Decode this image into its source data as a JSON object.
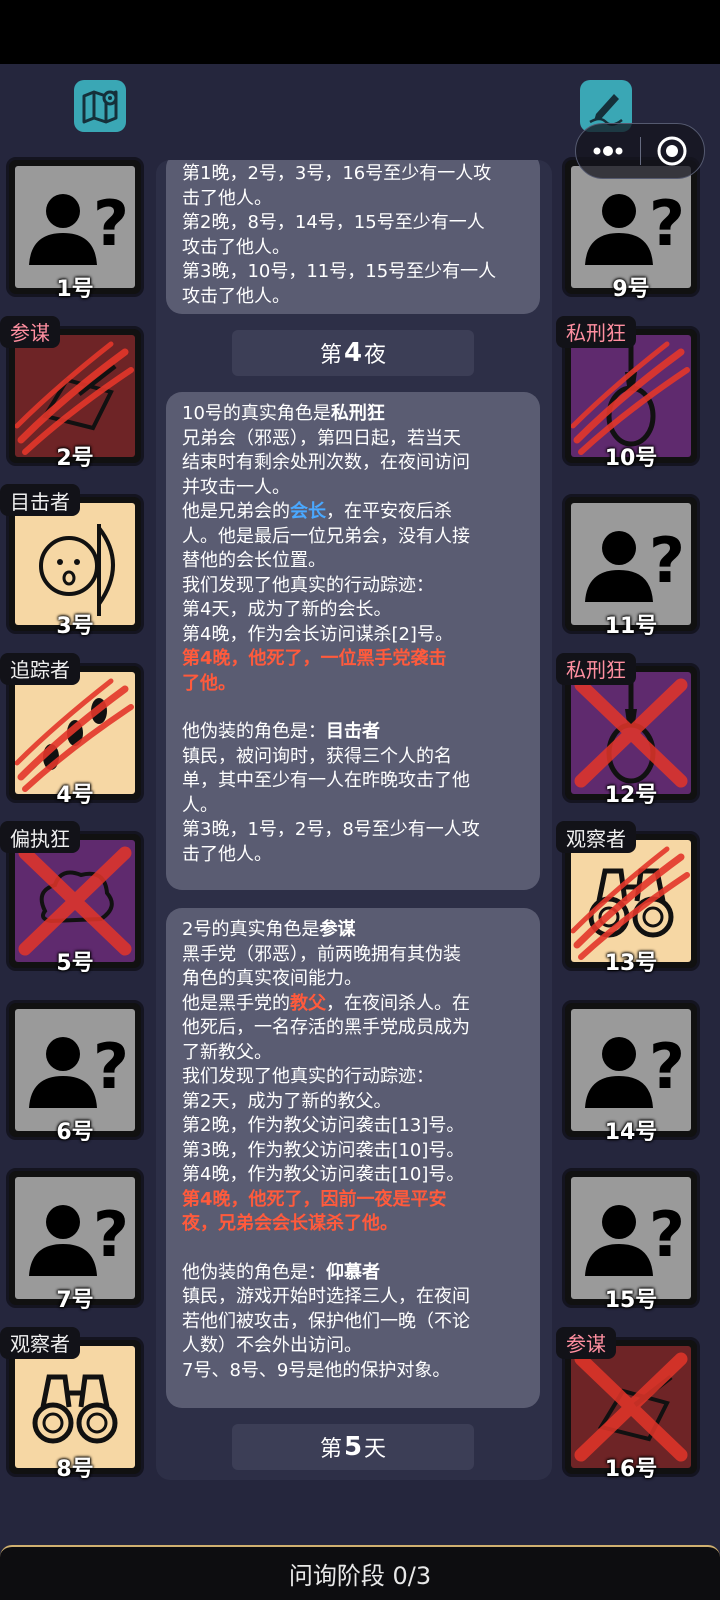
{
  "footer": {
    "phase": "问询阶段 0/3"
  },
  "toolbar": {
    "map_icon": "map-icon",
    "notes_icon": "notes-pencil-icon"
  },
  "capsule": {
    "more_icon": "more-dots-icon",
    "close_icon": "target-close-icon"
  },
  "players_left": [
    {
      "num": "1号",
      "role": "",
      "art": "unknown"
    },
    {
      "num": "2号",
      "role": "参谋",
      "art": "advisor",
      "status": "attacked"
    },
    {
      "num": "3号",
      "role": "目击者",
      "art": "witness"
    },
    {
      "num": "4号",
      "role": "追踪者",
      "art": "tracker",
      "status": "attacked"
    },
    {
      "num": "5号",
      "role": "偏执狂",
      "art": "paranoid",
      "status": "dead"
    },
    {
      "num": "6号",
      "role": "",
      "art": "unknown"
    },
    {
      "num": "7号",
      "role": "",
      "art": "unknown"
    },
    {
      "num": "8号",
      "role": "观察者",
      "art": "observer"
    }
  ],
  "players_right": [
    {
      "num": "9号",
      "role": "",
      "art": "unknown"
    },
    {
      "num": "10号",
      "role": "私刑狂",
      "art": "lyncher",
      "status": "attacked"
    },
    {
      "num": "11号",
      "role": "",
      "art": "unknown"
    },
    {
      "num": "12号",
      "role": "私刑狂",
      "art": "lyncher",
      "status": "dead"
    },
    {
      "num": "13号",
      "role": "观察者",
      "art": "observer",
      "status": "attacked"
    },
    {
      "num": "14号",
      "role": "",
      "art": "unknown"
    },
    {
      "num": "15号",
      "role": "",
      "art": "unknown"
    },
    {
      "num": "16号",
      "role": "参谋",
      "art": "advisor",
      "status": "dead"
    }
  ],
  "log": {
    "bubble1": {
      "l1": "第1晚，2号，3号，16号至少有一人攻",
      "l2": "击了他人。",
      "l3": "第2晚，8号，14号，15号至少有一人",
      "l4": "攻击了他人。",
      "l5": "第3晚，10号，11号，15号至少有一人",
      "l6": "攻击了他人。"
    },
    "night4": {
      "pre": "第",
      "num": "4",
      "post": "夜"
    },
    "bubble2": {
      "head_pre": "10号的真实角色是",
      "head_role": "私刑狂",
      "d1": "兄弟会（邪恶），第四日起，若当天",
      "d2": "结束时有剩余处刑次数，在夜间访问",
      "d3": "并攻击一人。",
      "t1a": "他是兄弟会的",
      "t1b": "会长",
      "t1c": "，在平安夜后杀",
      "t2": "人。他是最后一位兄弟会，没有人接",
      "t3": "替他的会长位置。",
      "tr0": "我们发现了他真实的行动踪迹：",
      "tr1": "第4天，成为了新的会长。",
      "tr2": "第4晚，作为会长访问谋杀[2]号。",
      "death1": "第4晚，他死了，一位黑手党袭击",
      "death2": "了他。",
      "fake_pre": "他伪装的角色是：",
      "fake_role": "目击者",
      "f1": "镇民，被问询时，获得三个人的名",
      "f2": "单，其中至少有一人在昨晚攻击了他",
      "f3": "人。",
      "f4": "第3晚，1号，2号，8号至少有一人攻",
      "f5": "击了他人。"
    },
    "bubble3": {
      "head_pre": "2号的真实角色是",
      "head_role": "参谋",
      "d1": "黑手党（邪恶），前两晚拥有其伪装",
      "d2": "角色的真实夜间能力。",
      "t1a": "他是黑手党的",
      "t1b": "教父",
      "t1c": "，在夜间杀人。在",
      "t2": "他死后，一名存活的黑手党成员成为",
      "t3": "了新教父。",
      "tr0": "我们发现了他真实的行动踪迹：",
      "tr1": "第2天，成为了新的教父。",
      "tr2": "第2晚，作为教父访问袭击[13]号。",
      "tr3": "第3晚，作为教父访问袭击[10]号。",
      "tr4": "第4晚，作为教父访问袭击[10]号。",
      "death1": "第4晚，他死了，因前一夜是平安",
      "death2": "夜，兄弟会会长谋杀了他。",
      "fake_pre": "他伪装的角色是：",
      "fake_role": "仰慕者",
      "f1": "镇民，游戏开始时选择三人，在夜间",
      "f2": "若他们被攻击，保护他们一晚（不论",
      "f3": "人数）不会外出访问。",
      "f4": "7号、8号、9号是他的保护对象。"
    },
    "day5": {
      "pre": "第",
      "num": "5",
      "post": "天"
    }
  }
}
